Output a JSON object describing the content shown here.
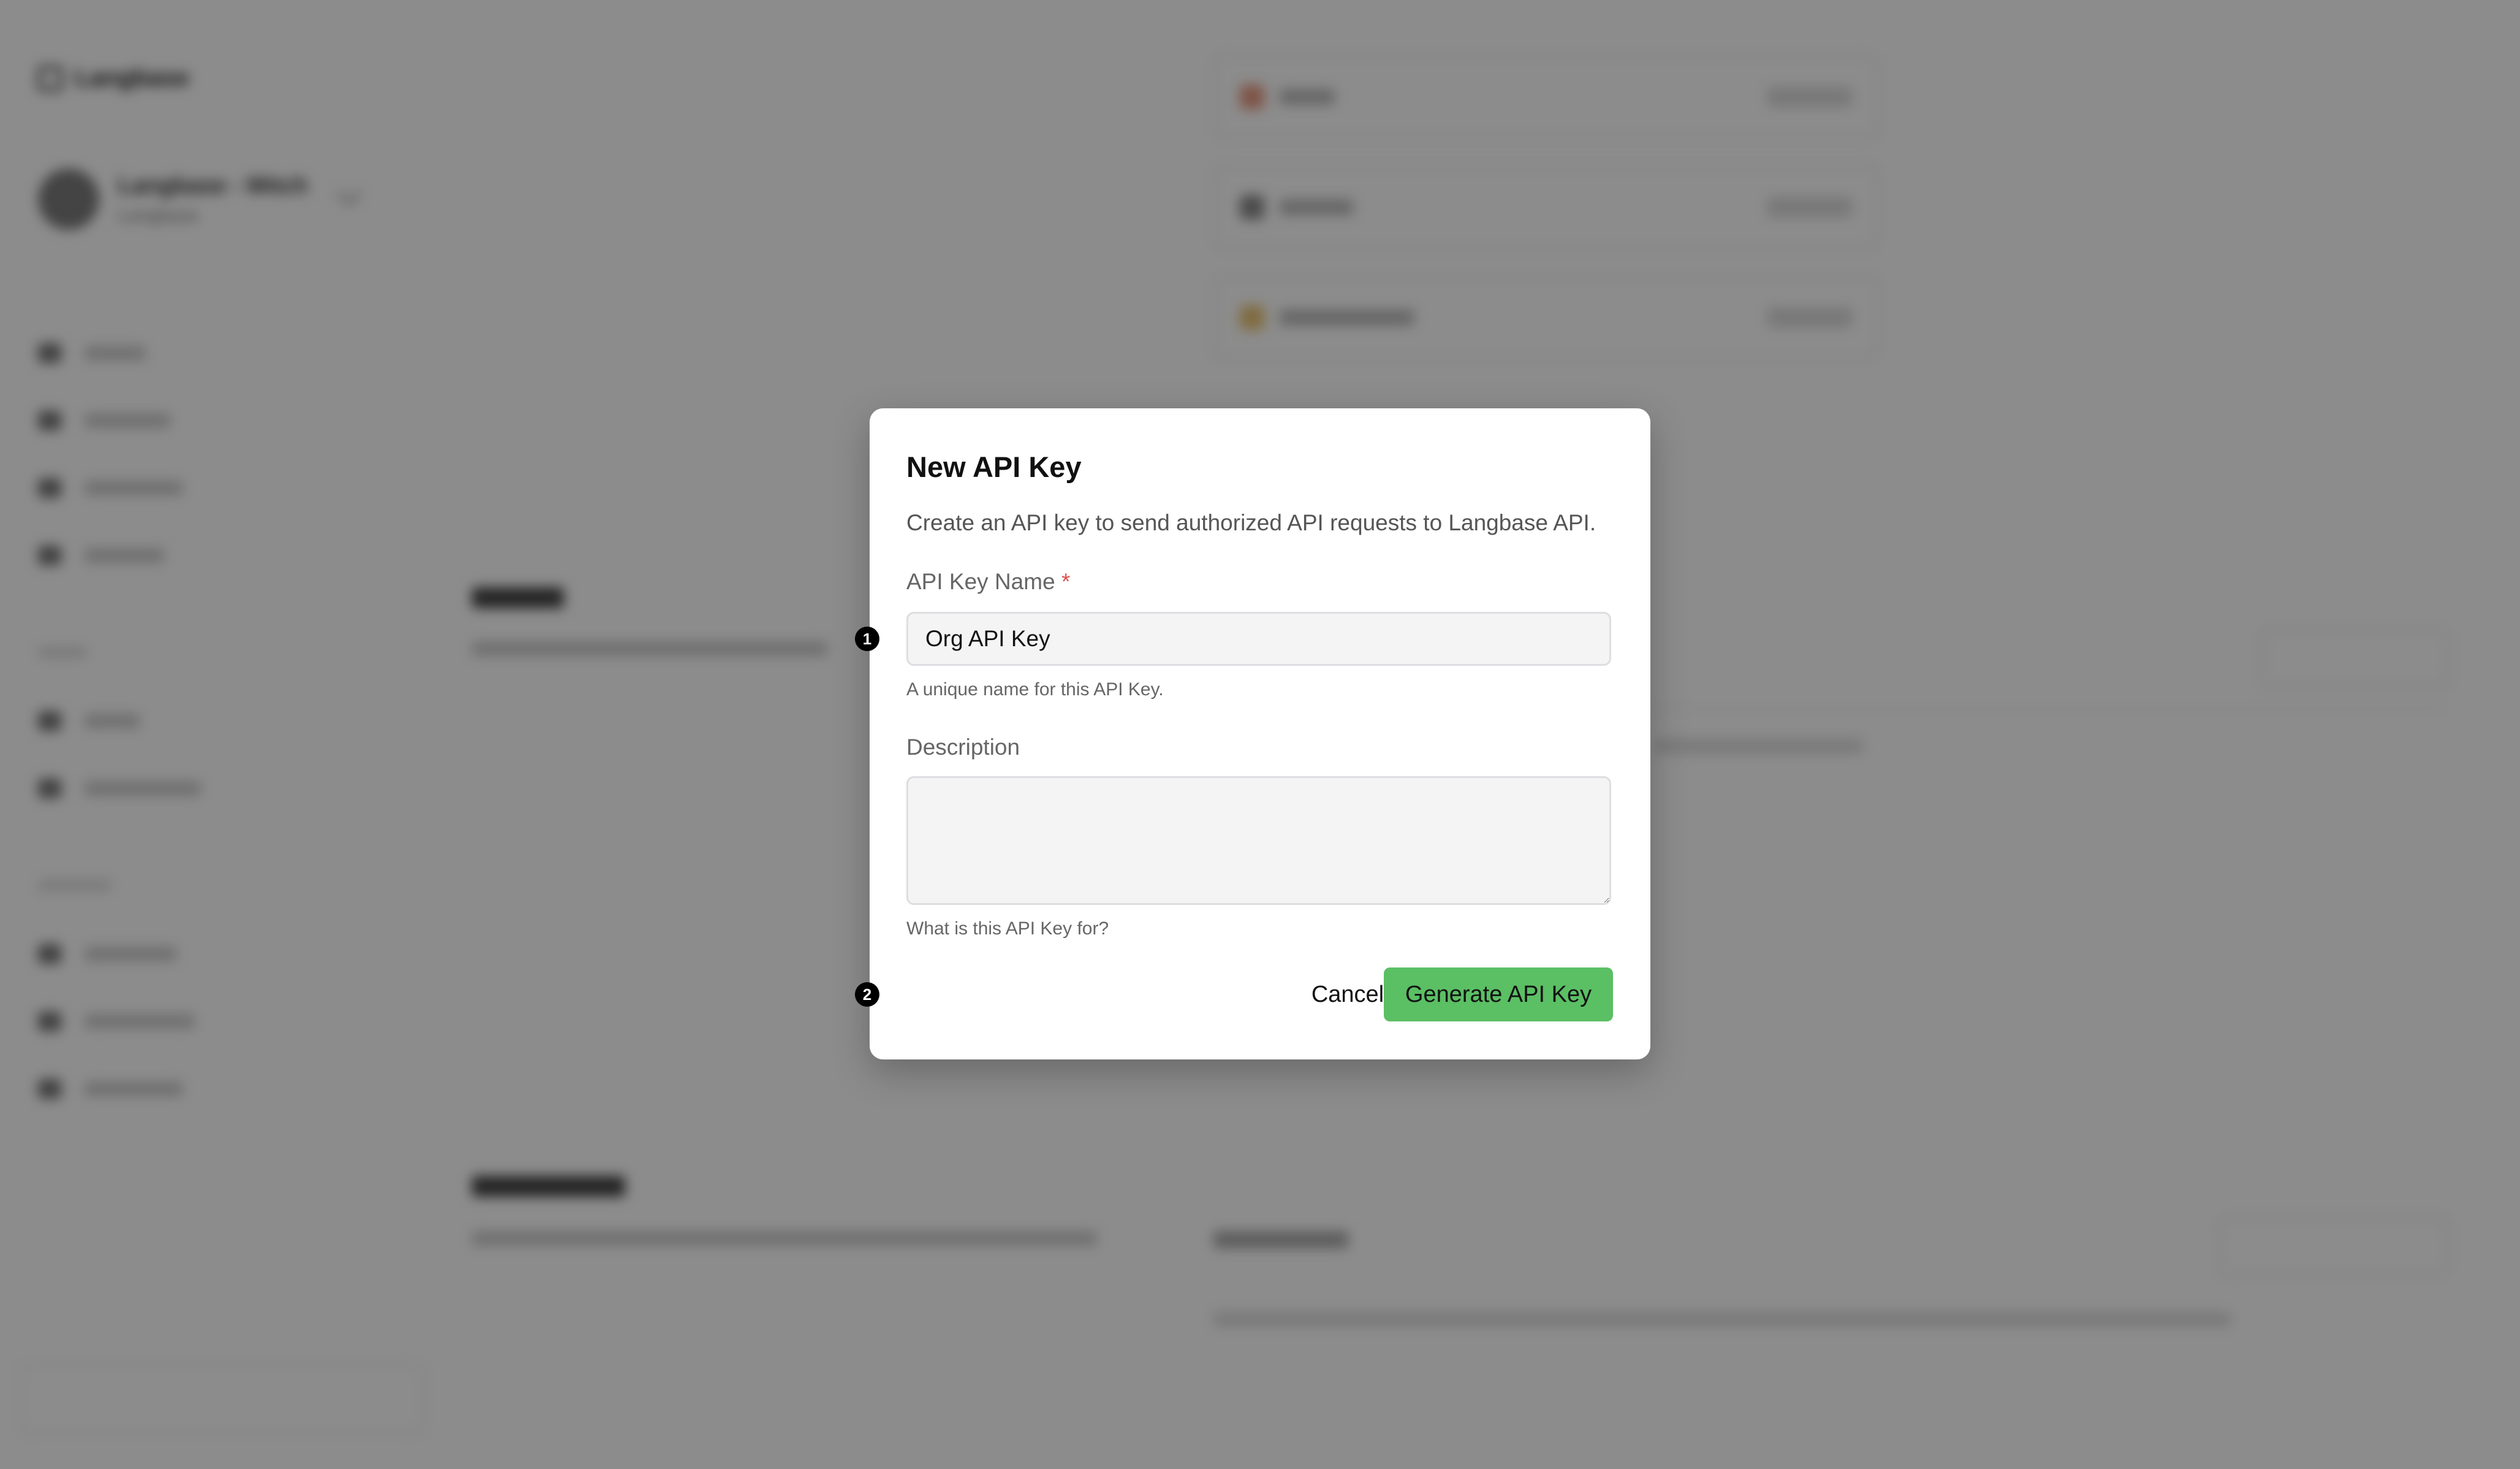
{
  "background": {
    "brand": "Langbase",
    "org": {
      "name": "Langbase - Mitch",
      "sub": "Langbase"
    }
  },
  "modal": {
    "title": "New API Key",
    "description": "Create an API key to send authorized API requests to Langbase API.",
    "name_label": "API Key Name",
    "required_mark": "*",
    "name_value": "Org API Key",
    "name_hint": "A unique name for this API Key.",
    "description_label": "Description",
    "description_value": "",
    "description_hint": "What is this API Key for?",
    "cancel_label": "Cancel",
    "generate_label": "Generate API Key"
  },
  "markers": [
    "1",
    "2"
  ],
  "colors": {
    "accent_green": "#5bbf64",
    "overlay": "rgba(0,0,0,0.45)",
    "required": "#d9534f"
  }
}
